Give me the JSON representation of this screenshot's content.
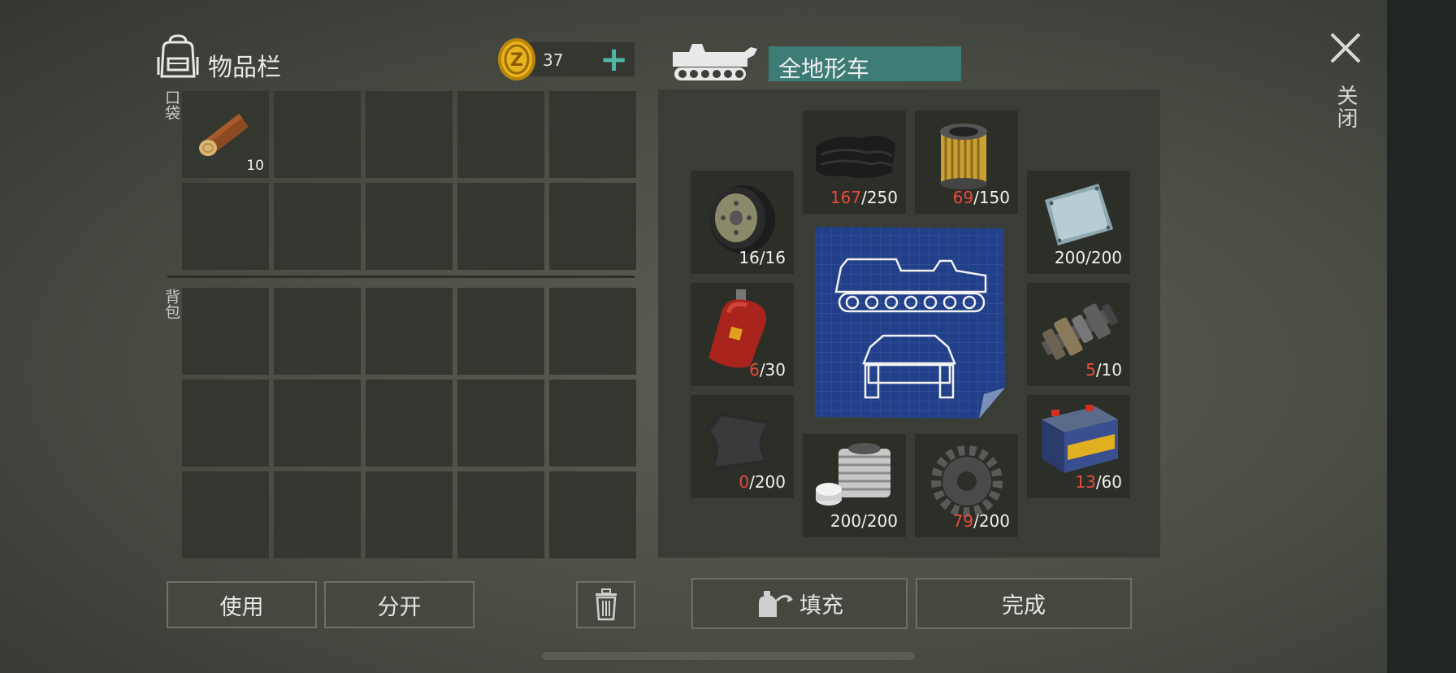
{
  "header": {
    "inventory_title": "物品栏",
    "coins": "37",
    "vehicle_name": "全地形车",
    "close_label": "关闭"
  },
  "sections": {
    "pocket_label": "口袋",
    "backpack_label": "背包"
  },
  "pocket_items": [
    {
      "icon": "wood-log-icon",
      "count": "10"
    }
  ],
  "vehicle_parts": [
    {
      "id": "cloth",
      "icon": "cloth-icon",
      "current": "167",
      "total": "/250",
      "complete": false
    },
    {
      "id": "filter",
      "icon": "air-filter-icon",
      "current": "69",
      "total": "/150",
      "complete": false
    },
    {
      "id": "wheel",
      "icon": "wheel-icon",
      "current": "16",
      "total": "/16",
      "complete": true
    },
    {
      "id": "plate",
      "icon": "metal-plate-icon",
      "current": "200",
      "total": "/200",
      "complete": true
    },
    {
      "id": "gas",
      "icon": "gas-cylinder-icon",
      "current": "6",
      "total": "/30",
      "complete": false
    },
    {
      "id": "gearbox",
      "icon": "transmission-icon",
      "current": "5",
      "total": "/10",
      "complete": false
    },
    {
      "id": "rubber",
      "icon": "rubber-sheet-icon",
      "current": "0",
      "total": "/200",
      "complete": false
    },
    {
      "id": "battery",
      "icon": "battery-icon",
      "current": "13",
      "total": "/60",
      "complete": false
    },
    {
      "id": "cylinder",
      "icon": "engine-cylinder-icon",
      "current": "200",
      "total": "/200",
      "complete": true
    },
    {
      "id": "gear",
      "icon": "gear-part-icon",
      "current": "79",
      "total": "/200",
      "complete": false
    }
  ],
  "buttons": {
    "use": "使用",
    "split": "分开",
    "fill": "填充",
    "done": "完成"
  },
  "colors": {
    "accent_teal": "#3d7c75",
    "plus_teal": "#4fb7a7",
    "deficit_red": "#e84a3b"
  }
}
